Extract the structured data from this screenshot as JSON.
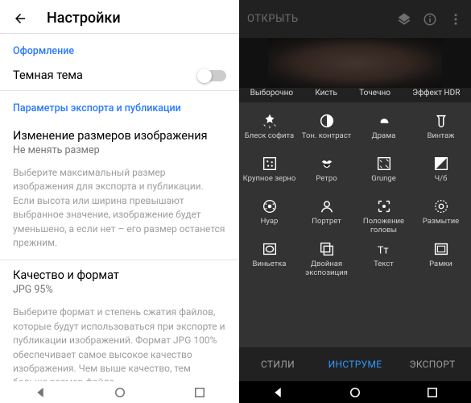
{
  "left": {
    "title": "Настройки",
    "section1": "Оформление",
    "darkTheme": "Темная тема",
    "section2": "Параметры экспорта и публикации",
    "resize": {
      "title": "Изменение размеров изображения",
      "sub": "Не менять размер"
    },
    "resizeDesc": "Выберите максимальный размер изображения для экспорта и публикации. Если высота или ширина превышают выбранное значение, изображение будет уменьшено, а если нет – его размер останется прежним.",
    "quality": {
      "title": "Качество и формат",
      "sub": "JPG 95%"
    },
    "qualityDesc": "Выберите формат и степень сжатия файлов, которые будут использоваться при экспорте и публикации изображений. Формат JPG 100% обеспечивает самое высокое качество изображения. Чем выше качество, тем больше размер файла."
  },
  "right": {
    "open": "ОТКРЫТЬ",
    "topRow": [
      "Выборочно",
      "Кисть",
      "Точечно",
      "Эффект HDR"
    ],
    "tools": [
      [
        {
          "name": "glamour",
          "label": "Блеск софита"
        },
        {
          "name": "tonal",
          "label": "Тон. контраст"
        },
        {
          "name": "drama",
          "label": "Драма"
        },
        {
          "name": "vintage",
          "label": "Винтаж"
        }
      ],
      [
        {
          "name": "grain",
          "label": "Крупное зерно"
        },
        {
          "name": "retro",
          "label": "Ретро"
        },
        {
          "name": "grunge",
          "label": "Grunge"
        },
        {
          "name": "bw",
          "label": "Ч/б"
        }
      ],
      [
        {
          "name": "noir",
          "label": "Нуар"
        },
        {
          "name": "portrait",
          "label": "Портрет"
        },
        {
          "name": "headpose",
          "label": "Положение головы"
        },
        {
          "name": "blur",
          "label": "Размытие"
        }
      ],
      [
        {
          "name": "vignette",
          "label": "Виньетка"
        },
        {
          "name": "double",
          "label": "Двойная экспозиция"
        },
        {
          "name": "text",
          "label": "Текст"
        },
        {
          "name": "frames",
          "label": "Рамки"
        }
      ]
    ],
    "tabs": {
      "styles": "СТИЛИ",
      "tools": "ИНСТРУМЕ",
      "export": "ЭКСПОРТ"
    }
  }
}
